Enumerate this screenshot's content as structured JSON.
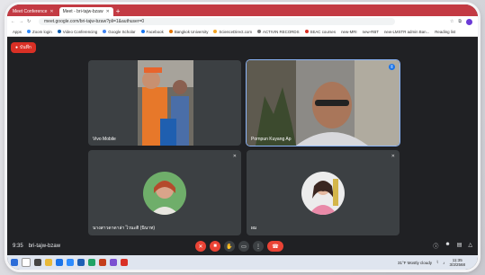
{
  "browser": {
    "tabs": [
      {
        "label": "Meet Conference",
        "active": false
      },
      {
        "label": "Meet - bri-tajw-bzaw",
        "active": true
      }
    ],
    "url": "meet.google.com/bri-tajw-bzaw?pli=1&authuser=0",
    "bookmarks": [
      "Apps",
      "Zoom login",
      "Video Conferencing",
      "Google Scholar",
      "Facebook",
      "Bangkok University",
      "ScienceDirect.com",
      "ACTIVIN RECORDS",
      "SEAC courses",
      "new-MRI",
      "new-RBT",
      "new-LMSTR admin Ban...",
      "Reading list"
    ]
  },
  "meet": {
    "recording_badge": "บันทึก",
    "participants": [
      {
        "name": "Vivo Mobile",
        "mic": "",
        "speaking": false
      },
      {
        "name": "Pornpun Kuyang Ap",
        "mic": "⦀",
        "speaking": true
      },
      {
        "name": "นางสาวดาดาล่า ไวนะติ (นินาท)",
        "mic": "✕",
        "speaking": false
      },
      {
        "name": "ผม",
        "mic": "✕",
        "speaking": false
      }
    ],
    "time": "9:35",
    "meeting_code": "bri-tajw-bzaw"
  },
  "taskbar": {
    "weather": "31°F Mostly cloudy",
    "time": "11:35",
    "date": "3/3/2568"
  },
  "colors": {
    "accent": "#1a73e8",
    "end_call": "#ea4335",
    "tab_strip": "#c33a43"
  }
}
